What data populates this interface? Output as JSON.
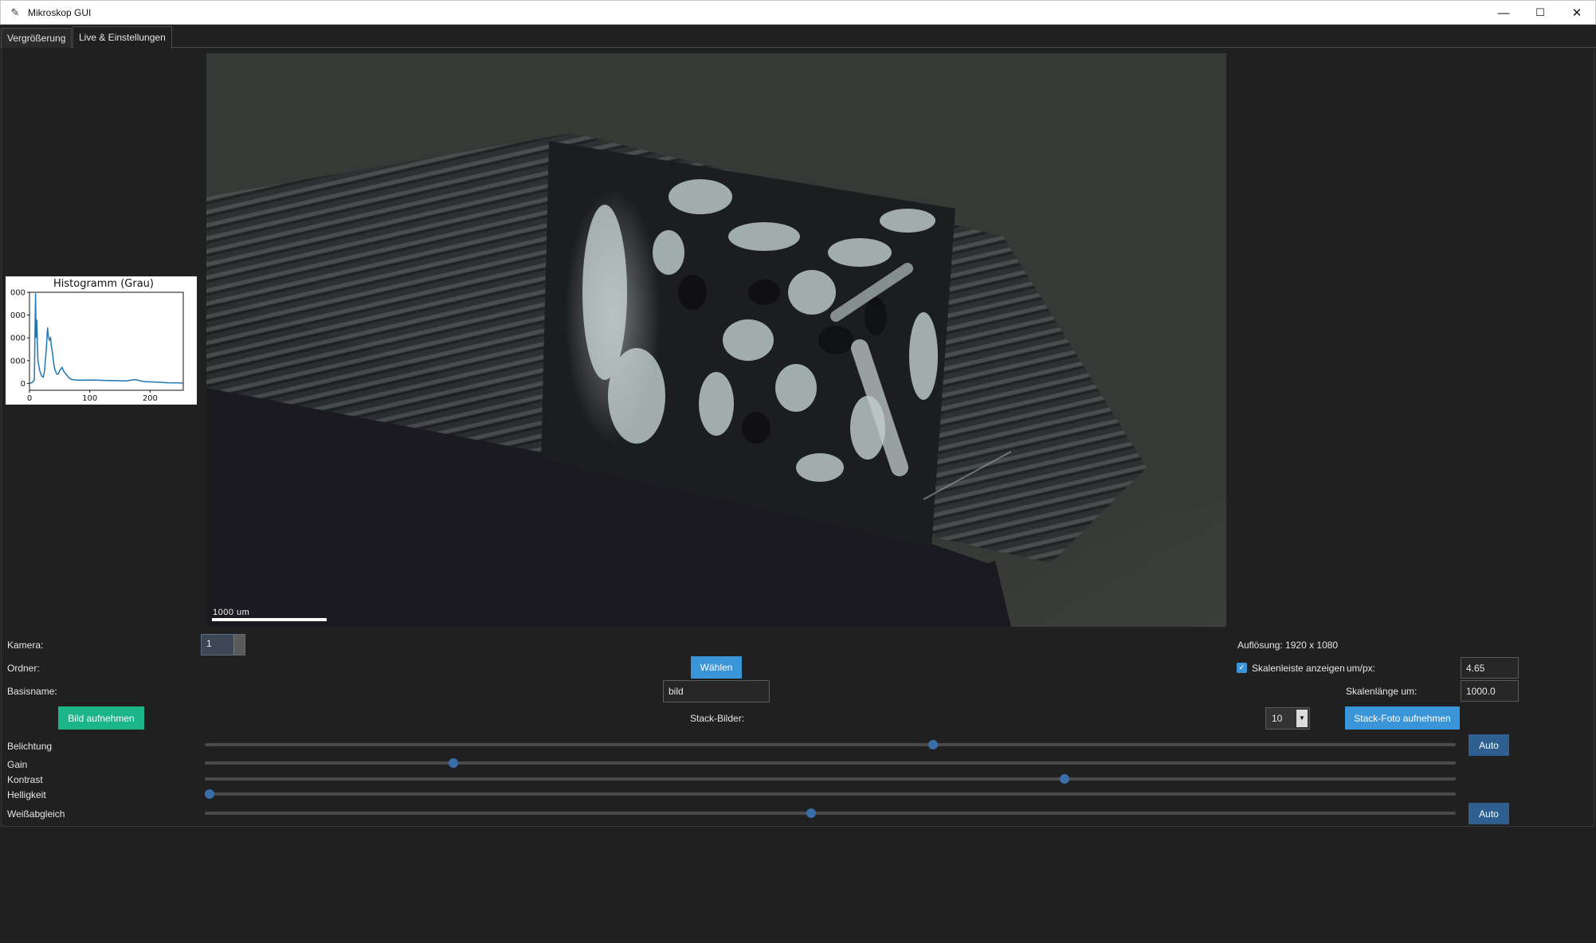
{
  "window": {
    "title": "Mikroskop GUI",
    "app_icon": "feather-icon",
    "controls": {
      "minimize": "—",
      "maximize": "☐",
      "close": "✕"
    }
  },
  "tabs": [
    {
      "label": "Vergrößerung",
      "active": false
    },
    {
      "label": "Live & Einstellungen",
      "active": true
    }
  ],
  "histogram": {
    "chart_data": {
      "type": "line",
      "title": "Histogramm (Grau)",
      "xlabel": "",
      "ylabel": "",
      "xlim": [
        0,
        255
      ],
      "ylim": [
        -300,
        4000
      ],
      "x_ticks": [
        "0",
        "100",
        "200"
      ],
      "y_tick_labels": [
        "0",
        "000",
        "000",
        "000",
        "000"
      ],
      "series": [
        {
          "color": "#1f77b4",
          "x": [
            0,
            5,
            8,
            10,
            11,
            12,
            14,
            17,
            20,
            23,
            25,
            28,
            30,
            31,
            33,
            35,
            36,
            38,
            40,
            42,
            44,
            46,
            48,
            50,
            54,
            57,
            62,
            65,
            68,
            72,
            78,
            85,
            100,
            130,
            160,
            175,
            190,
            210,
            230,
            250,
            255
          ],
          "y": [
            0,
            50,
            150,
            3950,
            2000,
            2800,
            1000,
            550,
            330,
            280,
            550,
            1550,
            2450,
            2100,
            1900,
            2000,
            1700,
            1350,
            900,
            620,
            480,
            400,
            420,
            560,
            700,
            520,
            360,
            260,
            190,
            160,
            150,
            140,
            150,
            130,
            110,
            170,
            80,
            60,
            30,
            20,
            10
          ]
        }
      ]
    }
  },
  "viewer": {
    "scalebar_label": "1000 um"
  },
  "controls": {
    "kamera_label": "Kamera:",
    "kamera_value": "1",
    "ordner_label": "Ordner:",
    "waehlen_button": "Wählen",
    "basisname_label": "Basisname:",
    "basisname_value": "bild",
    "bild_aufnehmen_button": "Bild aufnehmen",
    "stack_bilder_label": "Stack-Bilder:",
    "stack_bilder_value": "10",
    "stack_foto_button": "Stack-Foto aufnehmen",
    "aufloesung_text": "Auflösung: 1920 x 1080",
    "skalenleiste_label": "Skalenleiste anzeigen",
    "skalenleiste_checked": true,
    "umpx_label": "um/px:",
    "umpx_value": "4.65",
    "skalenlaenge_label": "Skalenlänge um:",
    "skalenlaenge_value": "1000.0",
    "auto_label": "Auto"
  },
  "sliders": [
    {
      "name": "belichtung",
      "label": "Belichtung",
      "level": 0.582,
      "auto": true
    },
    {
      "name": "gain",
      "label": "Gain",
      "level": 0.199,
      "auto": false
    },
    {
      "name": "kontrast",
      "label": "Kontrast",
      "level": 0.687,
      "auto": false
    },
    {
      "name": "helligkeit",
      "label": "Helligkeit",
      "level": 0.004,
      "auto": false
    },
    {
      "name": "weissabgleich",
      "label": "Weißabgleich",
      "level": 0.485,
      "auto": true
    }
  ]
}
